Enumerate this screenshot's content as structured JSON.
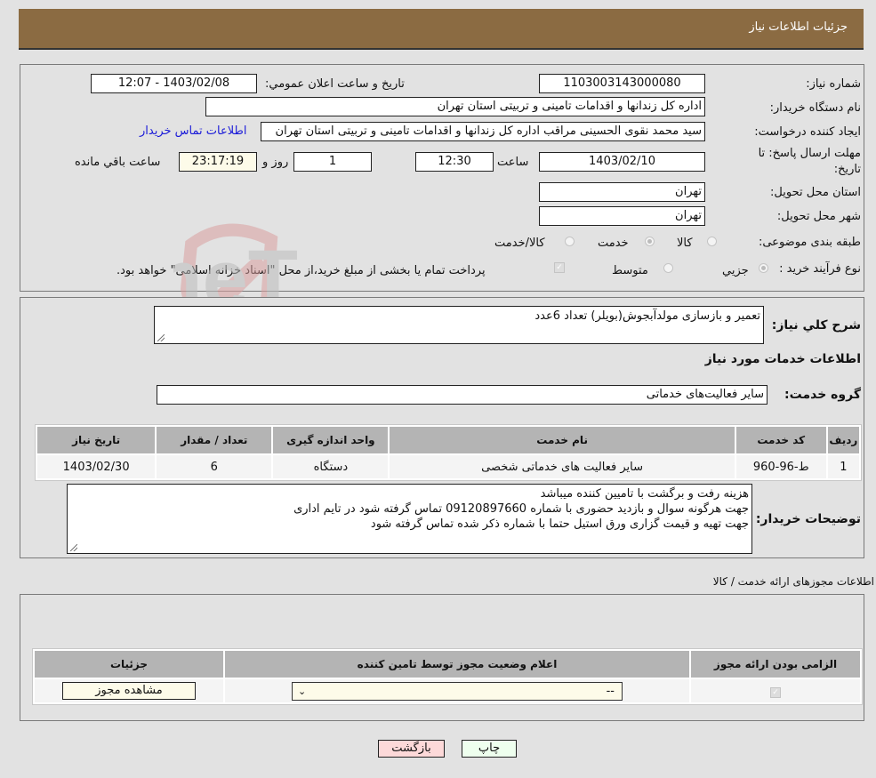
{
  "header": {
    "title": "جزئيات اطلاعات نياز"
  },
  "info": {
    "need_number_label": "شماره نیاز:",
    "need_number": "1103003143000080",
    "announce_label": "تاريخ و ساعت اعلان عمومي:",
    "announce_value": "1403/02/08 - 12:07",
    "buyer_org_label": "نام دستگاه خریدار:",
    "buyer_org": "اداره کل زندانها و اقدامات تامینی و تربیتی استان تهران",
    "creator_label": "ایجاد کننده درخواست:",
    "creator": "سید محمد نقوی الحسینی مراقب  اداره کل زندانها و اقدامات تامینی و تربیتی استان تهران",
    "contact_link": "اطلاعات تماس خریدار",
    "deadline_label": "مهلت ارسال پاسخ: تا تاریخ:",
    "deadline_date": "1403/02/10",
    "time_label": "ساعت",
    "deadline_time": "12:30",
    "days_value": "1",
    "days_label": "روز و",
    "remaining_time": "23:17:19",
    "remaining_label": "ساعت باقي مانده",
    "province_label": "استان محل تحویل:",
    "province": "تهران",
    "city_label": "شهر محل تحویل:",
    "city": "تهران",
    "category_label": "طبقه بندی موضوعی:",
    "category_options": [
      {
        "label": "کالا",
        "checked": false
      },
      {
        "label": "خدمت",
        "checked": true
      },
      {
        "label": "کالا/خدمت",
        "checked": false
      }
    ],
    "process_label": "نوع فرآیند خرید :",
    "process_options": [
      {
        "label": "جزيي",
        "checked": true
      },
      {
        "label": "متوسط",
        "checked": false
      }
    ],
    "treasury_note": "پرداخت تمام یا بخشی از مبلغ خرید،از محل \"اسناد خزانه اسلامی\" خواهد بود.",
    "treasury_checked": true
  },
  "description": {
    "label": "شرح کلي نياز:",
    "value": "تعمیر و بازسازی مولدآبجوش(بویلر) تعداد 6عدد",
    "services_title": "اطلاعات خدمات مورد نياز",
    "group_label": "گروه خدمت:",
    "group_value": "سایر فعالیت‌های خدماتی"
  },
  "services_table": {
    "headers": [
      "رديف",
      "کد خدمت",
      "نام خدمت",
      "واحد اندازه گيری",
      "تعداد / مقدار",
      "تاريخ نياز"
    ],
    "rows": [
      [
        "1",
        "ط-96-960",
        "سایر فعالیت های خدماتی شخصی",
        "دستگاه",
        "6",
        "1403/02/30"
      ]
    ]
  },
  "buyer_notes": {
    "label": "توضيحات خريدار:",
    "lines": [
      "هزینه رفت و برگشت با تامیین کننده میباشد",
      "جهت هرگونه سوال و بازدید حضوری با شماره 09120897660 تماس گرفته شود در تایم اداری",
      "جهت تهیه و قیمت گزاری ورق استیل حتما با شماره ذکر شده تماس گرفته شود"
    ]
  },
  "permits": {
    "title": "اطلاعات مجوزهای ارائه خدمت / کالا",
    "headers": [
      "الزامی بودن ارائه مجوز",
      "اعلام وضعیت مجوز توسط تامین کننده",
      "جزئیات"
    ],
    "required_checked": true,
    "status_value": "--",
    "details_button": "مشاهده مجوز"
  },
  "footer": {
    "print_button": "چاپ",
    "back_button": "بازگشت"
  },
  "watermark": {
    "text": "AriaTender.neT"
  },
  "colors": {
    "header_bg": "#8b6b42",
    "link": "#1a1ad8",
    "back_btn": "#fdd9d9",
    "print_btn": "#eeffee"
  }
}
